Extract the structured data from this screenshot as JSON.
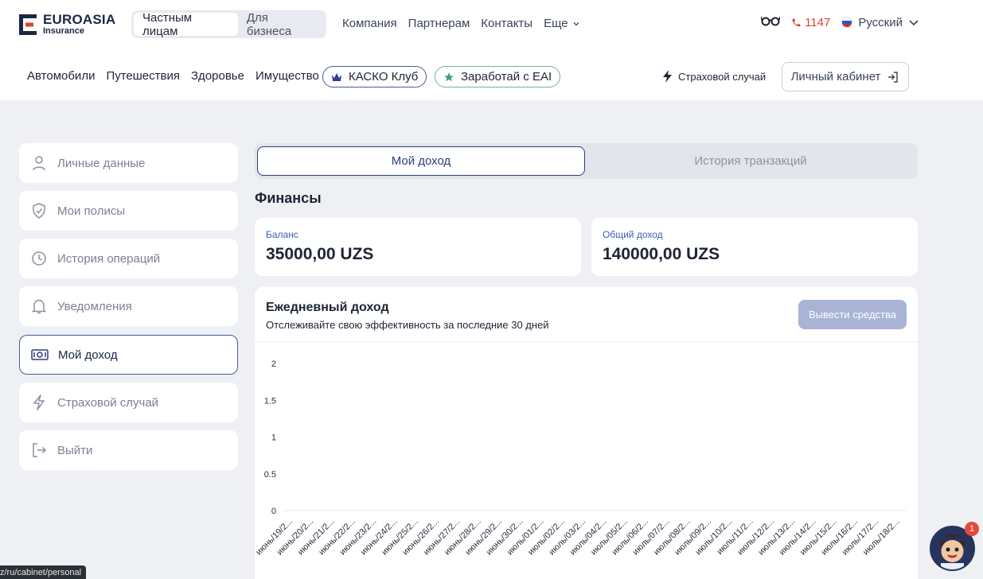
{
  "header": {
    "logo": {
      "name": "EUROASIA",
      "sub": "Insurance"
    },
    "audience_tabs": [
      {
        "label": "Частным лицам"
      },
      {
        "label": "Для бизнеса"
      }
    ],
    "top_nav": [
      {
        "label": "Компания"
      },
      {
        "label": "Партнерам"
      },
      {
        "label": "Контакты"
      },
      {
        "label": "Еще"
      }
    ],
    "phone": "1147",
    "language": "Русский",
    "categories": [
      {
        "label": "Автомобили"
      },
      {
        "label": "Путешествия"
      },
      {
        "label": "Здоровье"
      },
      {
        "label": "Имущество"
      }
    ],
    "casco_pill": "КАСКО Клуб",
    "earn_pill": "Заработай с EAI",
    "claim_link": "Страховой случай",
    "cabinet_button": "Личный кабинет"
  },
  "sidebar": {
    "items": [
      {
        "label": "Личные данные",
        "icon": "user-icon"
      },
      {
        "label": "Мои полисы",
        "icon": "shield-icon"
      },
      {
        "label": "История операций",
        "icon": "clock-icon"
      },
      {
        "label": "Уведомления",
        "icon": "bell-icon"
      },
      {
        "label": "Мой доход",
        "icon": "money-icon",
        "active": true
      },
      {
        "label": "Страховой случай",
        "icon": "lightning-icon"
      },
      {
        "label": "Выйти",
        "icon": "logout-icon"
      }
    ]
  },
  "main": {
    "tabs": [
      {
        "label": "Мой доход",
        "active": true
      },
      {
        "label": "История транзакций"
      }
    ],
    "section_title": "Финансы",
    "balance": {
      "label": "Баланс",
      "value": "35000,00 UZS"
    },
    "total_income": {
      "label": "Общий доход",
      "value": "140000,00 UZS"
    },
    "daily": {
      "title": "Ежедневный доход",
      "subtitle": "Отслеживайте свою эффективность за последние 30 дней",
      "withdraw_button": "Вывести средства"
    }
  },
  "chart_data": {
    "type": "line",
    "y_ticks": [
      "2",
      "1.5",
      "1",
      "0.5",
      "0"
    ],
    "ylim": [
      0,
      2
    ],
    "grid": "baseline only",
    "categories": [
      "июнь/19/2...",
      "июнь/20/2...",
      "июнь/21/2...",
      "июнь/22/2...",
      "июнь/23/2...",
      "июнь/24/2...",
      "июнь/25/2...",
      "июнь/26/2...",
      "июнь/27/2...",
      "июнь/28/2...",
      "июнь/29/2...",
      "июнь/30/2...",
      "июль/01/2...",
      "июль/02/2...",
      "июль/03/2...",
      "июль/04/2...",
      "июль/05/2...",
      "июль/06/2...",
      "июль/07/2...",
      "июль/08/2...",
      "июль/09/2...",
      "июль/10/2...",
      "июль/11/2...",
      "июль/12/2...",
      "июль/13/2...",
      "июль/14/2...",
      "июль/15/2...",
      "июль/16/2...",
      "июль/17/2...",
      "июль/18/2..."
    ],
    "values": [
      0,
      0,
      0,
      0,
      0,
      0,
      0,
      0,
      0,
      0,
      0,
      0,
      0,
      0,
      0,
      0,
      0,
      0,
      0,
      0,
      0,
      0,
      0,
      0,
      0,
      0,
      0,
      0,
      0,
      0
    ]
  },
  "status_url": "z/ru/cabinet/personal",
  "chat_badge": "1",
  "colors": {
    "brand": "#1c2745",
    "accent": "#2d3d7a",
    "link_blue": "#3b5fb5",
    "phone_red": "#d9432f",
    "button_disabled": "#a8b3d6"
  }
}
